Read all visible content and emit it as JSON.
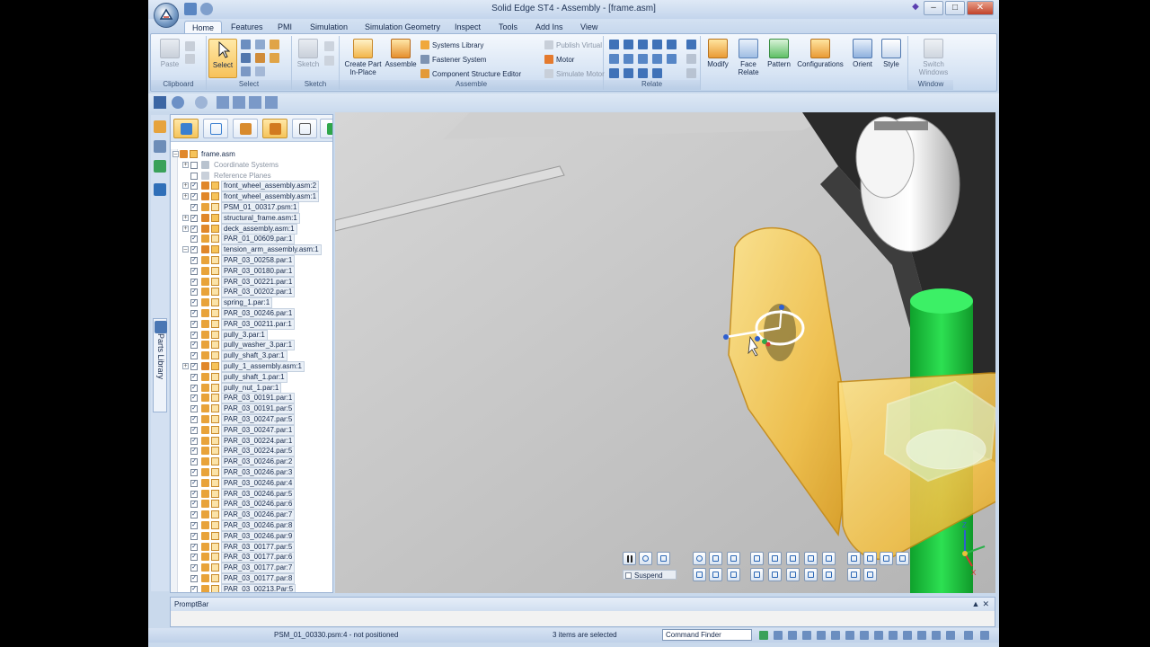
{
  "window": {
    "title": "Solid Edge ST4 - Assembly - [frame.asm]",
    "minimize": "–",
    "maximize": "□",
    "close": "✕"
  },
  "tabs": [
    {
      "label": "Home",
      "active": true
    },
    {
      "label": "Features"
    },
    {
      "label": "PMI"
    },
    {
      "label": "Simulation"
    },
    {
      "label": "Simulation Geometry"
    },
    {
      "label": "Inspect"
    },
    {
      "label": "Tools"
    },
    {
      "label": "Add Ins"
    },
    {
      "label": "View"
    }
  ],
  "ribbon": {
    "clipboard": {
      "label": "Clipboard",
      "paste": "Paste"
    },
    "select": {
      "label": "Select",
      "select": "Select"
    },
    "sketch": {
      "label": "Sketch",
      "sketch": "Sketch"
    },
    "assemble": {
      "label": "Assemble",
      "create_part": "Create Part In-Place",
      "assemble": "Assemble",
      "systems_library": "Systems Library",
      "fastener_system": "Fastener System",
      "component_structure_editor": "Component Structure Editor",
      "publish_virtual": "Publish Virtual",
      "motor": "Motor",
      "simulate_motor": "Simulate Motor"
    },
    "relate": {
      "label": "Relate"
    },
    "modify": {
      "modify": "Modify",
      "face_relate": "Face Relate",
      "pattern": "Pattern",
      "configurations": "Configurations",
      "orient": "Orient",
      "style": "Style"
    },
    "window": {
      "label": "Window",
      "switch_windows": "Switch Windows"
    }
  },
  "side_panel": {
    "parts_library": "Parts Library"
  },
  "pathfinder": {
    "items": [
      {
        "label": "frame.asm",
        "type": "asm",
        "expander": "minus",
        "checked": null,
        "boxed": false
      },
      {
        "label": "Coordinate Systems",
        "type": "coord",
        "expander": "plus",
        "checked": false,
        "grey": true
      },
      {
        "label": "Reference Planes",
        "type": "plane",
        "expander": null,
        "checked": false,
        "grey": true
      },
      {
        "label": "front_wheel_assembly.asm:2",
        "type": "asm",
        "expander": "plus",
        "checked": true,
        "boxed": true
      },
      {
        "label": "front_wheel_assembly.asm:1",
        "type": "asm",
        "expander": "plus",
        "checked": true,
        "boxed": true
      },
      {
        "label": "PSM_01_00317.psm:1",
        "type": "part",
        "expander": null,
        "checked": true,
        "boxed": true
      },
      {
        "label": "structural_frame.asm:1",
        "type": "asm",
        "expander": "plus",
        "checked": true,
        "boxed": true
      },
      {
        "label": "deck_assembly.asm:1",
        "type": "asm",
        "expander": "plus",
        "checked": true,
        "boxed": true
      },
      {
        "label": "PAR_01_00609.par:1",
        "type": "part",
        "expander": null,
        "checked": true,
        "boxed": true
      },
      {
        "label": "tension_arm_assembly.asm:1",
        "type": "asm",
        "expander": "minus",
        "checked": true,
        "boxed": true
      },
      {
        "label": "PAR_03_00258.par:1",
        "type": "part",
        "expander": null,
        "checked": true,
        "boxed": true
      },
      {
        "label": "PAR_03_00180.par:1",
        "type": "part",
        "expander": null,
        "checked": true,
        "boxed": true
      },
      {
        "label": "PAR_03_00221.par:1",
        "type": "part",
        "expander": null,
        "checked": true,
        "boxed": true
      },
      {
        "label": "PAR_03_00202.par:1",
        "type": "part",
        "expander": null,
        "checked": true,
        "boxed": true
      },
      {
        "label": "spring_1.par:1",
        "type": "part",
        "expander": null,
        "checked": true,
        "boxed": true
      },
      {
        "label": "PAR_03_00246.par:1",
        "type": "part",
        "expander": null,
        "checked": true,
        "boxed": true
      },
      {
        "label": "PAR_03_00211.par:1",
        "type": "part",
        "expander": null,
        "checked": true,
        "boxed": true
      },
      {
        "label": "pully_3.par:1",
        "type": "part",
        "expander": null,
        "checked": true,
        "boxed": true
      },
      {
        "label": "pully_washer_3.par:1",
        "type": "part",
        "expander": null,
        "checked": true,
        "boxed": true
      },
      {
        "label": "pully_shaft_3.par:1",
        "type": "part",
        "expander": null,
        "checked": true,
        "boxed": true
      },
      {
        "label": "pully_1_assembly.asm:1",
        "type": "asm",
        "expander": "plus",
        "checked": true,
        "boxed": true
      },
      {
        "label": "pully_shaft_1.par:1",
        "type": "part",
        "expander": null,
        "checked": true,
        "boxed": true
      },
      {
        "label": "pully_nut_1.par:1",
        "type": "part",
        "expander": null,
        "checked": true,
        "boxed": true
      },
      {
        "label": "PAR_03_00191.par:1",
        "type": "part",
        "expander": null,
        "checked": true,
        "boxed": true
      },
      {
        "label": "PAR_03_00191.par:5",
        "type": "part",
        "expander": null,
        "checked": true,
        "boxed": true
      },
      {
        "label": "PAR_03_00247.par:5",
        "type": "part",
        "expander": null,
        "checked": true,
        "boxed": true
      },
      {
        "label": "PAR_03_00247.par:1",
        "type": "part",
        "expander": null,
        "checked": true,
        "boxed": true
      },
      {
        "label": "PAR_03_00224.par:1",
        "type": "part",
        "expander": null,
        "checked": true,
        "boxed": true
      },
      {
        "label": "PAR_03_00224.par:5",
        "type": "part",
        "expander": null,
        "checked": true,
        "boxed": true
      },
      {
        "label": "PAR_03_00246.par:2",
        "type": "part",
        "expander": null,
        "checked": true,
        "boxed": true
      },
      {
        "label": "PAR_03_00246.par:3",
        "type": "part",
        "expander": null,
        "checked": true,
        "boxed": true
      },
      {
        "label": "PAR_03_00246.par:4",
        "type": "part",
        "expander": null,
        "checked": true,
        "boxed": true
      },
      {
        "label": "PAR_03_00246.par:5",
        "type": "part",
        "expander": null,
        "checked": true,
        "boxed": true
      },
      {
        "label": "PAR_03_00246.par:6",
        "type": "part",
        "expander": null,
        "checked": true,
        "boxed": true
      },
      {
        "label": "PAR_03_00246.par:7",
        "type": "part",
        "expander": null,
        "checked": true,
        "boxed": true
      },
      {
        "label": "PAR_03_00246.par:8",
        "type": "part",
        "expander": null,
        "checked": true,
        "boxed": true
      },
      {
        "label": "PAR_03_00246.par:9",
        "type": "part",
        "expander": null,
        "checked": true,
        "boxed": true
      },
      {
        "label": "PAR_03_00177.par:5",
        "type": "part",
        "expander": null,
        "checked": true,
        "boxed": true
      },
      {
        "label": "PAR_03_00177.par:6",
        "type": "part",
        "expander": null,
        "checked": true,
        "boxed": true
      },
      {
        "label": "PAR_03_00177.par:7",
        "type": "part",
        "expander": null,
        "checked": true,
        "boxed": true
      },
      {
        "label": "PAR_03_00177.par:8",
        "type": "part",
        "expander": null,
        "checked": true,
        "boxed": true
      },
      {
        "label": "PAR_03_00213.Par:5",
        "type": "part",
        "expander": null,
        "checked": true,
        "boxed": true
      }
    ]
  },
  "view_toolbar": {
    "suspend": "Suspend"
  },
  "triad": {
    "x": "X",
    "z": "Z"
  },
  "prompt_bar": {
    "title": "PromptBar",
    "controls": "▲✕"
  },
  "status_bar": {
    "left": "PSM_01_00330.psm:4 - not positioned",
    "middle": "3 items are selected",
    "command_finder": "Command Finder"
  },
  "colors": {
    "part_yellow": "#f5c84a",
    "shaft_green": "#19c93c",
    "ribbon_blue": "#d7e4f4",
    "viewport_grey": "#c5c5c5"
  }
}
